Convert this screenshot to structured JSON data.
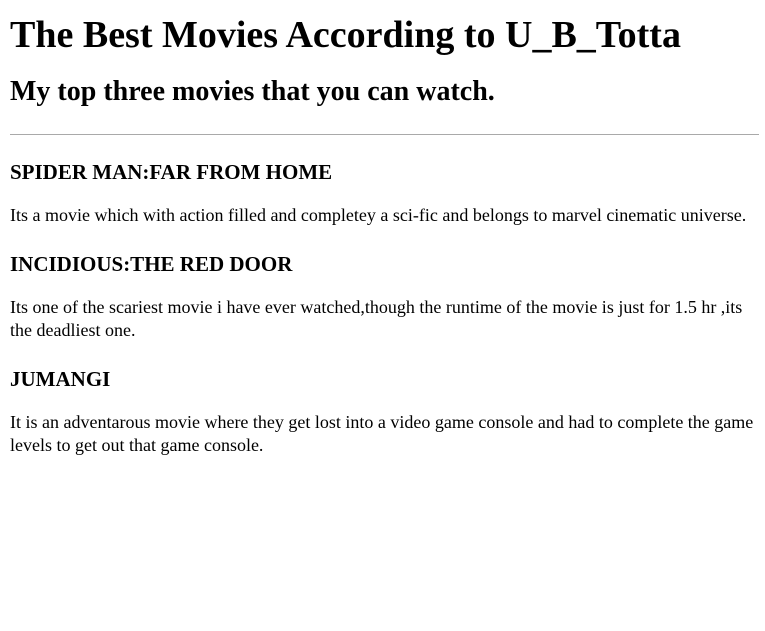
{
  "page": {
    "title": "The Best Movies According to U_B_Totta",
    "subtitle": "My top three movies that you can watch."
  },
  "movies": [
    {
      "title": "SPIDER MAN:FAR FROM HOME",
      "description": "Its a movie which with action filled and completey a sci-fic and belongs to marvel cinematic universe."
    },
    {
      "title": "INCIDIOUS:THE RED DOOR",
      "description": "Its one of the scariest movie i have ever watched,though the runtime of the movie is just for 1.5 hr ,its the deadliest one."
    },
    {
      "title": "JUMANGI",
      "description": "It is an adventarous movie where they get lost into a video game console and had to complete the game levels to get out that game console."
    }
  ]
}
